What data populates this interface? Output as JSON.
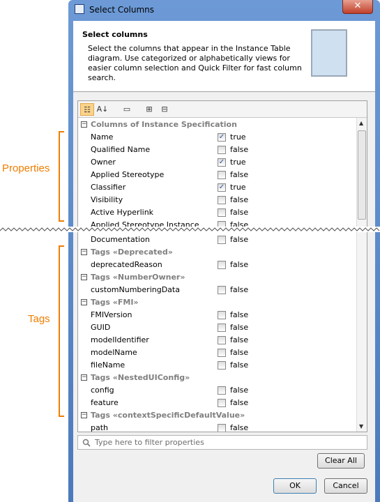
{
  "annotations": {
    "properties": "Properties",
    "tags": "Tags"
  },
  "window": {
    "title": "Select Columns",
    "close": "✕"
  },
  "header": {
    "title": "Select columns",
    "description": "Select the columns that appear in the Instance Table diagram. Use categorized or alphabetically views for easier column selection and Quick Filter for fast column search."
  },
  "toolbar": [
    {
      "icon": "categorized-icon",
      "glyph": "☷",
      "active": true
    },
    {
      "icon": "sort-alphabetically-icon",
      "glyph": "A↓"
    },
    {
      "icon": "description-icon",
      "glyph": "▭"
    },
    {
      "icon": "expand-all-icon",
      "glyph": "⊞"
    },
    {
      "icon": "collapse-all-icon",
      "glyph": "⊟"
    }
  ],
  "rows_top": [
    {
      "group": "Columns of Instance Specification"
    },
    {
      "name": "Name",
      "value": "true",
      "checked": true
    },
    {
      "name": "Qualified Name",
      "value": "false",
      "checked": false
    },
    {
      "name": "Owner",
      "value": "true",
      "checked": true
    },
    {
      "name": "Applied Stereotype",
      "value": "false",
      "checked": false
    },
    {
      "name": "Classifier",
      "value": "true",
      "checked": true
    },
    {
      "name": "Visibility",
      "value": "false",
      "checked": false
    },
    {
      "name": "Active Hyperlink",
      "value": "false",
      "checked": false
    },
    {
      "name": "Applied Stereotype Instance",
      "value": "false",
      "checked": false
    }
  ],
  "rows_bottom": [
    {
      "name": "Documentation",
      "value": "false",
      "checked": false
    },
    {
      "group": "Tags «Deprecated»"
    },
    {
      "name": "deprecatedReason",
      "value": "false",
      "checked": false
    },
    {
      "group": "Tags «NumberOwner»"
    },
    {
      "name": "customNumberingData",
      "value": "false",
      "checked": false
    },
    {
      "group": "Tags «FMI»"
    },
    {
      "name": "FMIVersion",
      "value": "false",
      "checked": false
    },
    {
      "name": "GUID",
      "value": "false",
      "checked": false
    },
    {
      "name": "modelIdentifier",
      "value": "false",
      "checked": false
    },
    {
      "name": "modelName",
      "value": "false",
      "checked": false
    },
    {
      "name": "fileName",
      "value": "false",
      "checked": false
    },
    {
      "group": "Tags «NestedUIConfig»"
    },
    {
      "name": "config",
      "value": "false",
      "checked": false
    },
    {
      "name": "feature",
      "value": "false",
      "checked": false
    },
    {
      "group": "Tags «contextSpecificDefaultValue»"
    },
    {
      "name": "path",
      "value": "false",
      "checked": false
    }
  ],
  "filter": {
    "placeholder": "Type here to filter properties"
  },
  "buttons": {
    "clear_all": "Clear All",
    "ok": "OK",
    "cancel": "Cancel"
  },
  "colors": {
    "annotation": "#f07d00",
    "titlebar": "#4c79bb",
    "group_text": "#7f7f7f"
  }
}
